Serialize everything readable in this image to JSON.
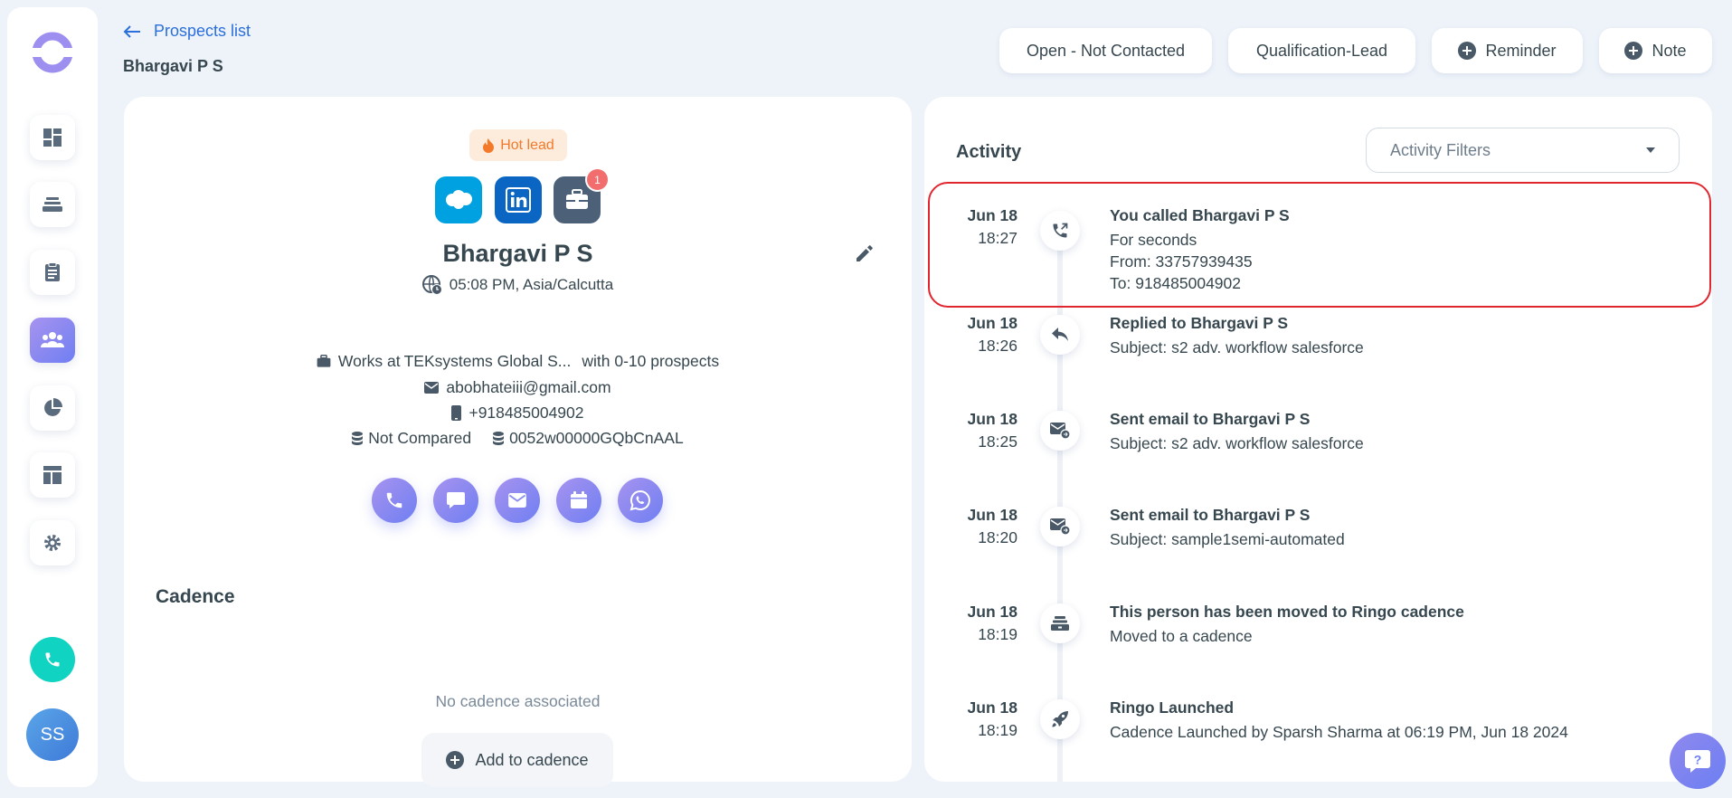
{
  "nav": {
    "items": [
      {
        "icon": "dashboard-icon",
        "active": false
      },
      {
        "icon": "tasks-inbox-icon",
        "active": false
      },
      {
        "icon": "clipboard-icon",
        "active": false
      },
      {
        "icon": "people-icon",
        "active": true
      },
      {
        "icon": "pie-chart-icon",
        "active": false
      },
      {
        "icon": "template-icon",
        "active": false
      },
      {
        "icon": "settings-icon",
        "active": false
      }
    ],
    "avatar_initials": "SS"
  },
  "header": {
    "back_label": "Prospects list",
    "title": "Bhargavi P S",
    "buttons": {
      "status": "Open - Not Contacted",
      "stage": "Qualification-Lead",
      "reminder": "Reminder",
      "note": "Note"
    }
  },
  "prospect": {
    "hot_lead": "Hot lead",
    "name": "Bhargavi P S",
    "local_time": "05:08 PM, Asia/Calcutta",
    "work_prefix": "Works at",
    "company": "TEKsystems Global S...",
    "company_suffix": "with 0-10 prospects",
    "email": "abobhateiii@gmail.com",
    "phone": "+918485004902",
    "compare_status": "Not Compared",
    "crm_id": "0052w00000GQbCnAAL",
    "integration_badge": "1"
  },
  "cadence": {
    "title": "Cadence",
    "empty": "No cadence associated",
    "add_label": "Add to cadence"
  },
  "activity": {
    "title": "Activity",
    "filter_placeholder": "Activity Filters",
    "items": [
      {
        "date": "Jun 18",
        "time": "18:27",
        "icon": "outgoing-call-icon",
        "title": "You called Bhargavi P S",
        "lines": [
          "For seconds",
          "From: 33757939435",
          "To: 918485004902"
        ]
      },
      {
        "date": "Jun 18",
        "time": "18:26",
        "icon": "reply-icon",
        "title": "Replied to Bhargavi P S",
        "lines": [
          "Subject: s2 adv. workflow salesforce"
        ]
      },
      {
        "date": "Jun 18",
        "time": "18:25",
        "icon": "email-sent-icon",
        "title": "Sent email to Bhargavi P S",
        "lines": [
          "Subject: s2 adv. workflow salesforce"
        ]
      },
      {
        "date": "Jun 18",
        "time": "18:20",
        "icon": "email-sent-icon",
        "title": "Sent email to Bhargavi P S",
        "lines": [
          "Subject: sample1semi-automated"
        ]
      },
      {
        "date": "Jun 18",
        "time": "18:19",
        "icon": "cadence-icon",
        "title": "This person has been moved to Ringo cadence",
        "lines": [
          "Moved to a cadence"
        ]
      },
      {
        "date": "Jun 18",
        "time": "18:19",
        "icon": "rocket-icon",
        "title": "Ringo Launched",
        "lines": [
          "Cadence Launched by Sparsh Sharma at 06:19 PM, Jun 18 2024"
        ]
      }
    ]
  },
  "colors": {
    "accent": "#2a6fdb",
    "primary_gradient_start": "#a793ef",
    "primary_gradient_end": "#6f7ff2",
    "hot_lead": "#f27a2a",
    "call_button": "#10d3c2",
    "highlight_border": "#e0262f",
    "salesforce": "#00a1e0",
    "linkedin": "#0a66c2"
  }
}
